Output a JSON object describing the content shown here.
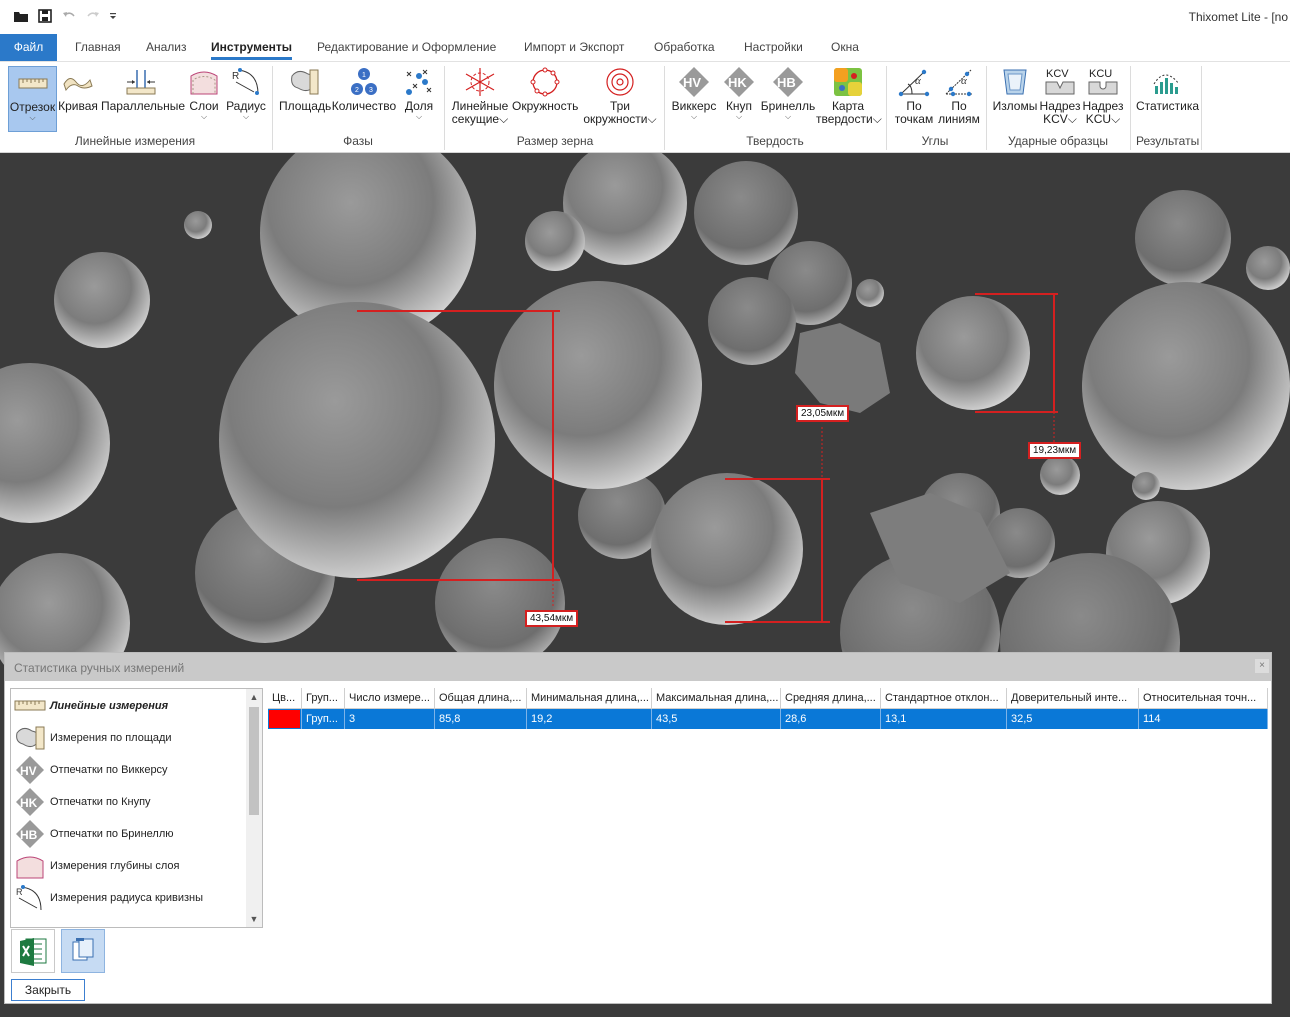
{
  "app_title": "Thixomet Lite - [no",
  "menu": {
    "tabs": [
      "Файл",
      "Главная",
      "Анализ",
      "Инструменты",
      "Редактирование и Оформление",
      "Импорт и Экспорт",
      "Обработка",
      "Настройки",
      "Окна"
    ],
    "active": "Инструменты"
  },
  "ribbon": {
    "groups": {
      "linear": "Линейные измерения",
      "phases": "Фазы",
      "grain": "Размер зерна",
      "hardness": "Твердость",
      "angles": "Углы",
      "impact": "Ударные образцы",
      "results": "Результаты"
    },
    "buttons": {
      "segment": "Отрезок",
      "curve": "Кривая",
      "parallel": "Параллельные",
      "layers": "Слои",
      "radius": "Радиус",
      "area": "Площадь",
      "count": "Количество",
      "fraction": "Доля",
      "linear_intercepts_1": "Линейные",
      "linear_intercepts_2": "секущие",
      "circle": "Окружность",
      "three_circles_1": "Три",
      "three_circles_2": "окружности",
      "vickers": "Виккерс",
      "knoop": "Кнуп",
      "brinell": "Бринелль",
      "hardness_map_1": "Карта",
      "hardness_map_2": "твердости",
      "by_points_1": "По",
      "by_points_2": "точкам",
      "by_lines_1": "По",
      "by_lines_2": "линиям",
      "fractures": "Изломы",
      "notch_kcv_1": "Надрез",
      "notch_kcv_2": "KCV",
      "notch_kcu_1": "Надрез",
      "notch_kcu_2": "KCU",
      "kcv_icon_text": "KCV",
      "kcu_icon_text": "KCU",
      "statistics": "Статистика"
    }
  },
  "measurements": [
    "43,54мкм",
    "23,05мкм",
    "19,23мкм"
  ],
  "dialog": {
    "title": "Статистика ручных измерений",
    "close_x": "×",
    "categories": [
      "Линейные измерения",
      "Измерения по площади",
      "Отпечатки по Виккерсу",
      "Отпечатки по Кнупу",
      "Отпечатки по Бринеллю",
      "Измерения глубины слоя",
      "Измерения радиуса кривизны"
    ],
    "close_button": "Закрыть",
    "columns": [
      "Цв...",
      "Груп...",
      "Число измере...",
      "Общая длина,...",
      "Минимальная длина,...",
      "Максимальная длина,...",
      "Средняя длина,...",
      "Стандартное отклон...",
      "Доверительный инте...",
      "Относительная точн..."
    ],
    "row": {
      "color": "#ff0000",
      "cells": [
        "",
        "Груп...",
        "3",
        "85,8",
        "19,2",
        "43,5",
        "28,6",
        "13,1",
        "32,5",
        "114"
      ]
    }
  },
  "colors": {
    "accent": "#2b79c9",
    "selection": "#0a78d7",
    "measure": "#d42020"
  }
}
